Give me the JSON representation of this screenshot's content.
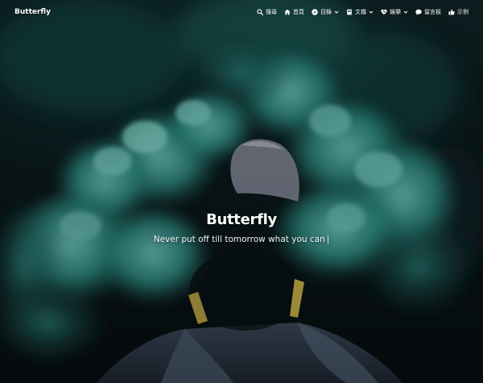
{
  "nav": {
    "brand": "Butterfly",
    "items": [
      {
        "label": "搜尋",
        "icon": "search-icon",
        "has_dropdown": false
      },
      {
        "label": "首頁",
        "icon": "home-icon",
        "has_dropdown": false
      },
      {
        "label": "目錄",
        "icon": "compass-icon",
        "has_dropdown": true
      },
      {
        "label": "文檔",
        "icon": "book-icon",
        "has_dropdown": true
      },
      {
        "label": "娛樂",
        "icon": "heart-icon",
        "has_dropdown": true
      },
      {
        "label": "留言板",
        "icon": "comment-icon",
        "has_dropdown": false
      },
      {
        "label": "示例",
        "icon": "thumbs-up-icon",
        "has_dropdown": false
      }
    ]
  },
  "site": {
    "title": "Butterfly",
    "subtitle": "Never put off till tomorrow what you can",
    "cursor": "|"
  },
  "colors": {
    "smoke": "#2e8f86",
    "smoke_light": "#5bb8ae",
    "background": "#0d1c1e",
    "text": "#ffffff"
  }
}
